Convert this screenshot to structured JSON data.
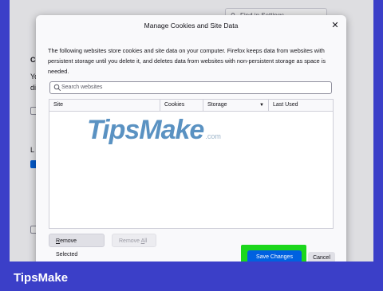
{
  "background": {
    "find_placeholder": "Find in Settings",
    "frag_c": "Co",
    "frag_yo": "Yo",
    "frag_di": "di",
    "frag_l": "L"
  },
  "dialog": {
    "title": "Manage Cookies and Site Data",
    "description": "The following websites store cookies and site data on your computer. Firefox keeps data from websites with persistent storage until you delete it, and deletes data from websites with non-persistent storage as space is needed.",
    "search_placeholder": "Search websites",
    "columns": [
      "Site",
      "Cookies",
      "Storage",
      "Last Used"
    ],
    "remove_selected_prefix": "R",
    "remove_selected_rest": "emove Selected",
    "remove_all_prefix": "Remove ",
    "remove_all_u": "A",
    "remove_all_rest": "ll",
    "save_label": "Save Changes",
    "cancel_label": "Cancel"
  },
  "watermark": {
    "main": "TipsMake",
    "suffix": ".com"
  },
  "brand": {
    "name": "TipsMake"
  },
  "colors": {
    "accent": "#0061e0",
    "highlight": "#1cd71c",
    "brand_bg": "#3b3fc8"
  },
  "icons": [
    "search-icon",
    "close-icon",
    "sort-down-icon"
  ]
}
